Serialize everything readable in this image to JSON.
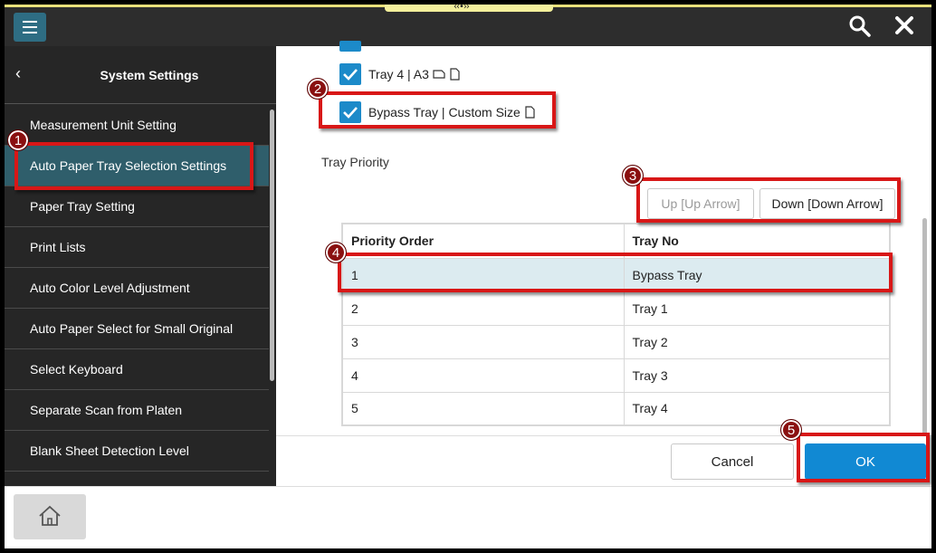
{
  "topbar": {
    "handle_glyph": "‹‹•››",
    "menu_icon": "hamburger-icon",
    "search_icon": "search-icon",
    "close_icon": "close-icon",
    "accent_color": "#e8e07a"
  },
  "sidebar": {
    "back_glyph": "‹",
    "title": "System Settings",
    "items": [
      {
        "label": "Measurement Unit Setting"
      },
      {
        "label": "Auto Paper Tray Selection Settings",
        "selected": true
      },
      {
        "label": "Paper Tray Setting"
      },
      {
        "label": "Print Lists"
      },
      {
        "label": "Auto Color Level Adjustment"
      },
      {
        "label": "Auto Paper Select for Small Original"
      },
      {
        "label": "Select Keyboard"
      },
      {
        "label": "Separate Scan from Platen"
      },
      {
        "label": "Blank Sheet Detection Level"
      }
    ]
  },
  "main": {
    "trays": [
      {
        "label": "Tray 4 | A3",
        "checked": true
      },
      {
        "label": "Bypass Tray | Custom Size",
        "checked": true
      }
    ],
    "tray_priority_label": "Tray Priority",
    "up_button": "Up [Up Arrow]",
    "down_button": "Down [Down Arrow]",
    "table": {
      "headers": [
        "Priority Order",
        "Tray No"
      ],
      "rows": [
        [
          "1",
          "Bypass Tray"
        ],
        [
          "2",
          "Tray 1"
        ],
        [
          "3",
          "Tray 2"
        ],
        [
          "4",
          "Tray 3"
        ],
        [
          "5",
          "Tray 4"
        ]
      ],
      "selected_row": 0
    },
    "cancel_button": "Cancel",
    "ok_button": "OK",
    "ok_color": "#1189d3"
  },
  "bottombar": {
    "home_icon": "home-icon"
  },
  "annotations": [
    "1",
    "2",
    "3",
    "4",
    "5"
  ]
}
